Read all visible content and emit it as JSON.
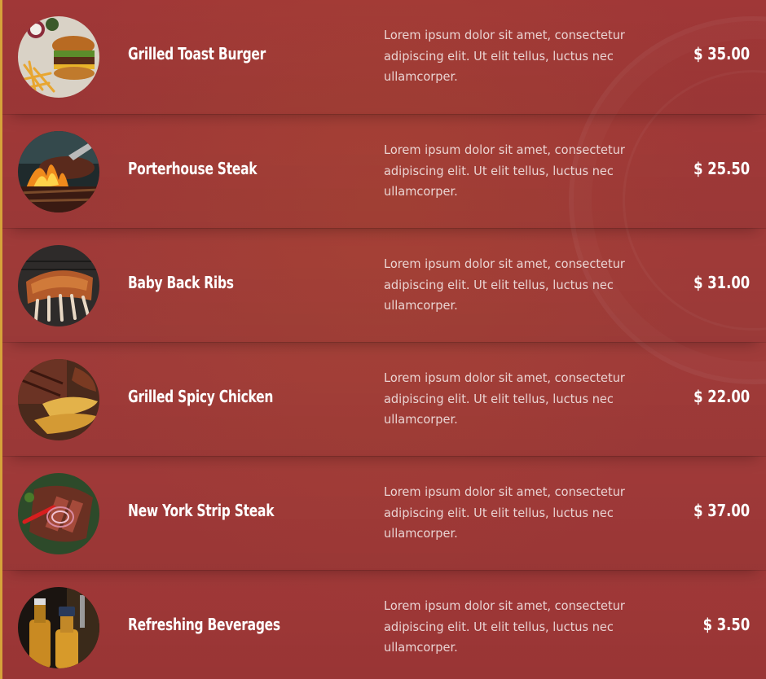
{
  "menu": {
    "items": [
      {
        "name": "Grilled Toast Burger",
        "description": "Lorem ipsum dolor sit amet, consectetur adipiscing elit. Ut elit tellus, luctus nec ullamcorper.",
        "price": "$ 35.00",
        "image": "burger-with-fries-photo"
      },
      {
        "name": "Porterhouse Steak",
        "description": "Lorem ipsum dolor sit amet, consectetur adipiscing elit. Ut elit tellus, luctus nec ullamcorper.",
        "price": "$ 25.50",
        "image": "steak-on-fire-grill-photo"
      },
      {
        "name": "Baby Back Ribs",
        "description": "Lorem ipsum dolor sit amet, consectetur adipiscing elit. Ut elit tellus, luctus nec ullamcorper.",
        "price": "$ 31.00",
        "image": "ribs-on-grill-photo"
      },
      {
        "name": "Grilled Spicy Chicken",
        "description": "Lorem ipsum dolor sit amet, consectetur adipiscing elit. Ut elit tellus, luctus nec ullamcorper.",
        "price": "$ 22.00",
        "image": "sliced-meat-and-potato-wedges-photo"
      },
      {
        "name": "New York Strip Steak",
        "description": "Lorem ipsum dolor sit amet, consectetur adipiscing elit. Ut elit tellus, luctus nec ullamcorper.",
        "price": "$ 37.00",
        "image": "sliced-steak-with-chili-photo"
      },
      {
        "name": "Refreshing Beverages",
        "description": "Lorem ipsum dolor sit amet, consectetur adipiscing elit. Ut elit tellus, luctus nec ullamcorper.",
        "price": "$ 3.50",
        "image": "bottled-drinks-photo"
      }
    ]
  },
  "colors": {
    "background": "#a33a3a",
    "accent_border": "#d6a33a",
    "text": "#ffffff"
  }
}
